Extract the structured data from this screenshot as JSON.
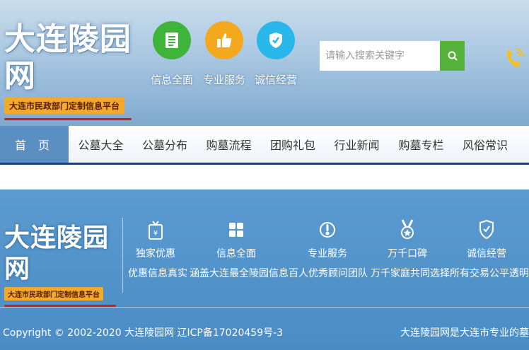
{
  "header": {
    "logo_title": "大连陵园网",
    "logo_sub": "大连市民政部门定制信息平台",
    "features": [
      {
        "label": "信息全面",
        "icon": "list-icon",
        "color": "#3fb33a"
      },
      {
        "label": "专业服务",
        "icon": "thumbs-up-icon",
        "color": "#f4a81d"
      },
      {
        "label": "诚信经营",
        "icon": "shield-icon",
        "color": "#27b8e9"
      }
    ],
    "search": {
      "placeholder": "请输入搜索关键字",
      "button_icon": "search-icon"
    },
    "phone_icon": "phone-icon"
  },
  "nav": {
    "items": [
      "首 页",
      "公墓大全",
      "公墓分布",
      "购墓流程",
      "团购礼包",
      "行业新闻",
      "购墓专栏",
      "风俗常识"
    ]
  },
  "footer": {
    "logo_title": "大连陵园网",
    "logo_sub": "大连市民政部门定制信息平台",
    "features": [
      {
        "title": "独家优惠",
        "desc": "优惠信息真实",
        "icon": "gift-icon"
      },
      {
        "title": "信息全面",
        "desc": "涵盖大连最全陵园信息",
        "icon": "grid-icon"
      },
      {
        "title": "专业服务",
        "desc": "百人优秀顾问团队",
        "icon": "thermometer-icon"
      },
      {
        "title": "万千口碑",
        "desc": "万千家庭共同选择",
        "icon": "medal-icon"
      },
      {
        "title": "诚信经营",
        "desc": "所有交易公平透明",
        "icon": "shield-icon"
      }
    ],
    "copyright": "Copyright © 2002-2020 大连陵园网 辽ICP备17020459号-3",
    "intro": "大连陵园网是大连市专业的墓"
  }
}
